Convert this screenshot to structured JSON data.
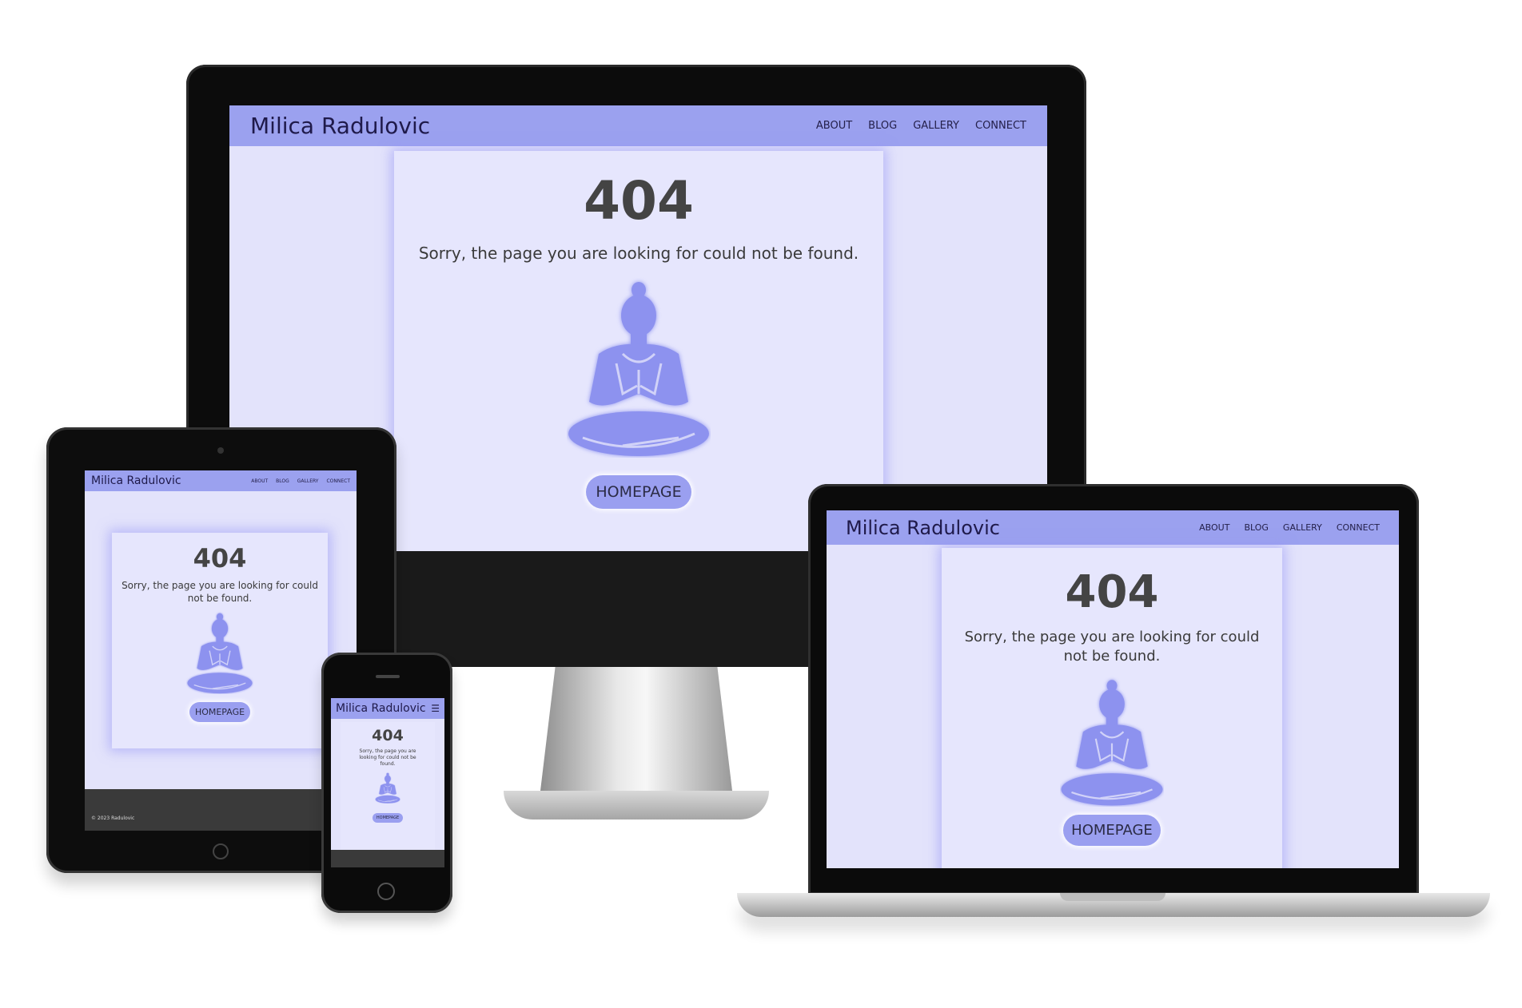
{
  "site": {
    "brand": "Milica Radulovic",
    "nav": [
      "ABOUT",
      "BLOG",
      "GALLERY",
      "CONNECT"
    ],
    "menu_icon": "hamburger-menu-icon",
    "error_code": "404",
    "error_message": "Sorry, the page you are looking for could not be found.",
    "button_label": "HOMEPAGE",
    "illustration": "meditating-figure-icon",
    "footer_text": "© 2023 Radulovic"
  },
  "devices": [
    "desktop-monitor",
    "tablet",
    "phone",
    "laptop"
  ],
  "colors": {
    "navbar": "#9ba1ef",
    "page_background": "#e3e3fb",
    "card": "#e6e6fd",
    "figure": "#8d92ef",
    "button": "#9a9ff0",
    "heading_text": "#444444",
    "footer": "#3a3a3a"
  }
}
